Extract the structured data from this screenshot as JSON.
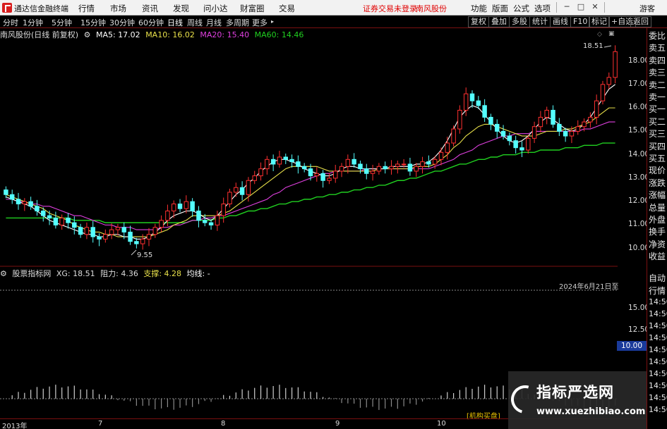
{
  "titlebar": {
    "app_title": "通达信金融终端",
    "menus": [
      "行情",
      "市场",
      "资讯",
      "发现",
      "问小达",
      "财富圈",
      "交易"
    ],
    "warning": "证券交易未登录",
    "stock_name": "南风股份",
    "right_menus": [
      "功能",
      "版面",
      "公式",
      "选项"
    ],
    "guest": "游客",
    "min_icon": "minimize-icon",
    "max_icon": "maximize-icon",
    "close_icon": "close-icon"
  },
  "periodbar": {
    "periods": [
      "分时",
      "1分钟",
      "5分钟",
      "15分钟",
      "30分钟",
      "60分钟",
      "日线",
      "周线",
      "月线",
      "多周期",
      "更多"
    ],
    "active": "日线",
    "tools": [
      "复权",
      "叠加",
      "多股",
      "统计",
      "画线",
      "F10",
      "标记",
      "+自选",
      "返回"
    ]
  },
  "main_header": {
    "title": "南风股份(日线 前复权)",
    "ma5": "MA5: 17.02",
    "ma10": "MA10: 16.02",
    "ma20": "MA20: 15.40",
    "ma60": "MA60: 14.46"
  },
  "main_axis": [
    "18.00",
    "17.00",
    "16.00",
    "15.00",
    "14.00",
    "13.00",
    "12.00",
    "11.00",
    "10.00"
  ],
  "annotations": {
    "high": "18.51",
    "low": "9.55"
  },
  "sub_header": {
    "name": "股票指标网",
    "xg": "XG: 18.51",
    "zl": "阻力: 4.36",
    "zc": "支撑: 4.28",
    "jx": "均线: -"
  },
  "sub_date": "2024年6月21日至",
  "sub_axis": [
    "15.00",
    "12.50"
  ],
  "range_badge": "10.00",
  "jg_tag": "[机构买盘]",
  "side_panel": {
    "items": [
      "委比",
      "卖五",
      "卖四",
      "卖三",
      "卖二",
      "卖一",
      "买一",
      "买二",
      "买三",
      "买四",
      "买五",
      "现价",
      "涨跌",
      "涨幅",
      "总量",
      "外盘",
      "换手",
      "净资",
      "收益"
    ],
    "tabs": [
      "自动",
      "行情"
    ],
    "times": [
      "14:50",
      "14:50",
      "14:50",
      "14:50",
      "14:50",
      "14:50",
      "14:50",
      "14:50",
      "14:50",
      "14:50"
    ]
  },
  "xaxis": [
    "2013年",
    "7",
    "8",
    "9",
    "10"
  ],
  "watermark": {
    "title": "指标严选网",
    "url": "www.xuezhibiao.com"
  },
  "colors": {
    "up": "#ff3030",
    "down": "#54ffff",
    "ma5": "#ffffff",
    "ma10": "#e8e04a",
    "ma20": "#e040e0",
    "ma60": "#20d020"
  },
  "chart_data": {
    "type": "candlestick",
    "ylim": [
      9.3,
      18.8
    ],
    "closes": [
      12.3,
      12.1,
      11.9,
      12.0,
      11.8,
      11.6,
      11.4,
      11.3,
      11.0,
      11.3,
      11.1,
      10.9,
      10.6,
      10.9,
      10.5,
      10.4,
      10.6,
      10.8,
      10.9,
      10.7,
      10.3,
      10.2,
      10.4,
      10.6,
      10.9,
      11.2,
      11.6,
      11.9,
      11.7,
      12.0,
      11.6,
      11.2,
      11.1,
      11.0,
      11.4,
      11.9,
      12.4,
      12.6,
      12.3,
      12.9,
      13.1,
      13.4,
      13.8,
      13.6,
      13.9,
      13.8,
      13.7,
      13.5,
      13.4,
      13.1,
      13.2,
      12.9,
      13.0,
      13.3,
      13.5,
      13.8,
      13.6,
      13.4,
      13.2,
      13.3,
      13.5,
      13.4,
      13.5,
      13.6,
      13.6,
      13.3,
      13.5,
      13.7,
      13.6,
      13.8,
      14.1,
      14.5,
      15.1,
      15.9,
      16.6,
      16.3,
      16.1,
      15.6,
      15.3,
      15.0,
      14.8,
      14.6,
      14.3,
      14.2,
      14.7,
      15.2,
      15.6,
      15.9,
      15.3,
      15.0,
      14.8,
      15.0,
      15.2,
      15.4,
      15.6,
      16.3,
      17.0,
      17.3,
      18.4
    ],
    "ma5": [
      12.2,
      12.1,
      12.0,
      11.9,
      11.8,
      11.6,
      11.4,
      11.2,
      11.1,
      11.0,
      10.9,
      10.8,
      10.7,
      10.6,
      10.6,
      10.5,
      10.5,
      10.6,
      10.6,
      10.5,
      10.5,
      10.4,
      10.4,
      10.5,
      10.7,
      10.9,
      11.2,
      11.4,
      11.5,
      11.6,
      11.6,
      11.5,
      11.3,
      11.2,
      11.4,
      11.7,
      12.0,
      12.3,
      12.5,
      12.8,
      13.0,
      13.3,
      13.5,
      13.7,
      13.8,
      13.8,
      13.7,
      13.6,
      13.4,
      13.3,
      13.2,
      13.1,
      13.1,
      13.2,
      13.4,
      13.5,
      13.5,
      13.4,
      13.4,
      13.4,
      13.4,
      13.4,
      13.5,
      13.5,
      13.5,
      13.5,
      13.6,
      13.6,
      13.7,
      13.9,
      14.2,
      14.6,
      15.1,
      15.6,
      15.9,
      16.1,
      16.0,
      15.7,
      15.4,
      15.1,
      14.8,
      14.6,
      14.5,
      14.6,
      14.8,
      15.1,
      15.4,
      15.6,
      15.5,
      15.3,
      15.1,
      15.0,
      15.1,
      15.3,
      15.6,
      16.0,
      16.4,
      16.8,
      17.0
    ],
    "ma10": [
      12.3,
      12.2,
      12.1,
      12.0,
      11.9,
      11.8,
      11.7,
      11.5,
      11.4,
      11.3,
      11.2,
      11.0,
      10.9,
      10.8,
      10.7,
      10.7,
      10.6,
      10.6,
      10.5,
      10.5,
      10.5,
      10.5,
      10.5,
      10.5,
      10.6,
      10.7,
      10.8,
      11.0,
      11.1,
      11.2,
      11.4,
      11.4,
      11.4,
      11.4,
      11.4,
      11.5,
      11.6,
      11.8,
      12.0,
      12.2,
      12.4,
      12.6,
      12.8,
      13.0,
      13.2,
      13.4,
      13.5,
      13.5,
      13.5,
      13.5,
      13.5,
      13.4,
      13.3,
      13.3,
      13.3,
      13.3,
      13.3,
      13.3,
      13.3,
      13.3,
      13.4,
      13.4,
      13.4,
      13.4,
      13.4,
      13.4,
      13.5,
      13.5,
      13.5,
      13.6,
      13.8,
      14.0,
      14.3,
      14.5,
      14.8,
      15.0,
      15.2,
      15.3,
      15.3,
      15.2,
      15.1,
      15.0,
      14.9,
      14.8,
      14.8,
      14.8,
      14.9,
      15.0,
      15.0,
      15.0,
      15.1,
      15.1,
      15.2,
      15.3,
      15.4,
      15.6,
      15.8,
      16.0,
      16.0
    ],
    "ma20": [
      12.1,
      12.1,
      12.0,
      12.0,
      11.9,
      11.9,
      11.8,
      11.8,
      11.7,
      11.6,
      11.5,
      11.4,
      11.4,
      11.3,
      11.2,
      11.1,
      11.0,
      11.0,
      10.9,
      10.9,
      10.9,
      10.8,
      10.8,
      10.8,
      10.8,
      10.9,
      10.9,
      11.0,
      11.0,
      11.1,
      11.2,
      11.2,
      11.3,
      11.3,
      11.4,
      11.4,
      11.5,
      11.6,
      11.7,
      11.8,
      11.9,
      12.0,
      12.1,
      12.3,
      12.4,
      12.6,
      12.7,
      12.8,
      12.9,
      13.0,
      13.1,
      13.2,
      13.2,
      13.3,
      13.3,
      13.3,
      13.3,
      13.3,
      13.4,
      13.4,
      13.4,
      13.4,
      13.4,
      13.4,
      13.4,
      13.4,
      13.4,
      13.4,
      13.4,
      13.5,
      13.6,
      13.7,
      13.8,
      14.0,
      14.1,
      14.2,
      14.4,
      14.5,
      14.6,
      14.7,
      14.8,
      14.8,
      14.9,
      14.9,
      14.9,
      15.0,
      15.0,
      15.0,
      15.0,
      15.0,
      15.0,
      15.0,
      15.0,
      15.1,
      15.1,
      15.2,
      15.3,
      15.4,
      15.4
    ],
    "ma60": [
      11.3,
      11.3,
      11.3,
      11.3,
      11.3,
      11.3,
      11.3,
      11.3,
      11.3,
      11.3,
      11.3,
      11.2,
      11.2,
      11.2,
      11.2,
      11.2,
      11.1,
      11.1,
      11.1,
      11.1,
      11.1,
      11.1,
      11.1,
      11.1,
      11.1,
      11.1,
      11.1,
      11.1,
      11.1,
      11.1,
      11.2,
      11.2,
      11.2,
      11.2,
      11.3,
      11.3,
      11.4,
      11.4,
      11.5,
      11.6,
      11.6,
      11.7,
      11.7,
      11.8,
      11.9,
      11.9,
      12.0,
      12.0,
      12.1,
      12.1,
      12.2,
      12.2,
      12.3,
      12.3,
      12.4,
      12.4,
      12.5,
      12.5,
      12.6,
      12.6,
      12.7,
      12.7,
      12.8,
      12.9,
      12.9,
      13.0,
      13.0,
      13.1,
      13.2,
      13.3,
      13.3,
      13.4,
      13.5,
      13.6,
      13.6,
      13.7,
      13.8,
      13.8,
      13.9,
      13.9,
      14.0,
      14.0,
      14.0,
      14.1,
      14.1,
      14.1,
      14.2,
      14.2,
      14.2,
      14.2,
      14.3,
      14.3,
      14.3,
      14.4,
      14.4,
      14.4,
      14.5,
      14.5,
      14.5
    ]
  }
}
